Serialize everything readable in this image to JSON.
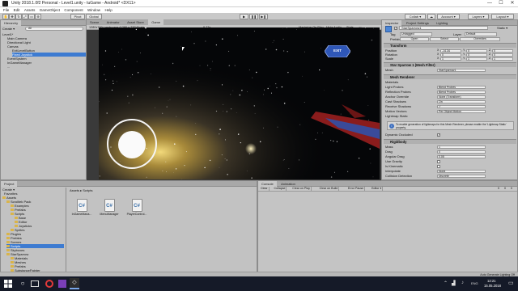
{
  "window": {
    "title": "Unity 2018.1.0f2 Personal - Level1.unity - tuGame - Android* <DX11>",
    "controls": [
      "—",
      "☐",
      "✕"
    ]
  },
  "menu": [
    "File",
    "Edit",
    "Assets",
    "GameObject",
    "Component",
    "Window",
    "Help"
  ],
  "toolbar": {
    "pivot": "Pivot",
    "global": "Global",
    "collab": "Collab ▾",
    "account": "Account ▾",
    "layers": "Layers ▾",
    "layout": "Layout ▾"
  },
  "hierarchy": {
    "tab": "Hierarchy",
    "create": "Create ▾",
    "search_placeholder": "All",
    "items": [
      {
        "label": "Level1*",
        "depth": 0
      },
      {
        "label": "Main Camera",
        "depth": 1
      },
      {
        "label": "Directional Light",
        "depth": 1
      },
      {
        "label": "Canvas",
        "depth": 1
      },
      {
        "label": "ExitLevelButton",
        "depth": 2
      },
      {
        "label": "Fixed Joystick",
        "depth": 2
      },
      {
        "label": "EventSystem",
        "depth": 1
      },
      {
        "label": "InGameManager",
        "depth": 1
      },
      {
        "label": "...",
        "depth": 1
      }
    ]
  },
  "center_tabs": [
    "Scene",
    "Animator",
    "Asset Store",
    "Game"
  ],
  "game_bar": {
    "display": "1280x720 Landscape (1280 x 720)",
    "scale_label": "Scale",
    "scale_value": "0.77x",
    "options": [
      "Maximize On Play",
      "Mute Audio",
      "Stats",
      "Gizmos ▾"
    ]
  },
  "game": {
    "exit_label": "EXIT"
  },
  "inspector": {
    "tabs": [
      "Inspector",
      "Project Settings",
      "Lighting"
    ],
    "object_name": "StarSparrow1",
    "static_label": "Static ▾",
    "tag_label": "Tag",
    "tag_value": "Untagged",
    "layer_label": "Layer",
    "layer_value": "Default",
    "prefab_label": "Prefab",
    "prefab_buttons": [
      "Open",
      "Select",
      "Overrides"
    ],
    "transform": {
      "title": "Transform",
      "rows": [
        {
          "label": "Position",
          "x": "-14.34",
          "y": "0",
          "z": "0"
        },
        {
          "label": "Rotation",
          "x": "0",
          "y": "0",
          "z": "0"
        },
        {
          "label": "Scale",
          "x": "1",
          "y": "1",
          "z": "1"
        }
      ]
    },
    "mesh_filter": {
      "title": "Star Sparrow 1 (Mesh Filter)",
      "mesh_label": "Mesh",
      "mesh_value": "StarSparrow1"
    },
    "mesh_renderer": {
      "title": "Mesh Renderer",
      "rows": [
        {
          "label": "Materials",
          "value": ""
        },
        {
          "label": "Light Probes",
          "value": "Blend Probes"
        },
        {
          "label": "Reflection Probes",
          "value": "Blend Probes"
        },
        {
          "label": "Anchor Override",
          "value": "None (Transform)"
        },
        {
          "label": "Cast Shadows",
          "value": "On"
        },
        {
          "label": "Receive Shadows",
          "value": "✓"
        },
        {
          "label": "Motion Vectors",
          "value": "Per Object Motion"
        },
        {
          "label": "Lightmap Static",
          "value": ""
        }
      ],
      "info": "To enable generation of lightmaps for this Mesh Renderer, please enable the 'Lightmap Static' property.",
      "dynamic_occluded": "Dynamic Occluded"
    },
    "rigidbody": {
      "title": "Rigidbody",
      "rows": [
        {
          "label": "Mass",
          "value": "1"
        },
        {
          "label": "Drag",
          "value": "0"
        },
        {
          "label": "Angular Drag",
          "value": "0.05"
        },
        {
          "label": "Use Gravity",
          "value": ""
        },
        {
          "label": "Is Kinematic",
          "value": ""
        },
        {
          "label": "Interpolate",
          "value": "None"
        },
        {
          "label": "Collision Detection",
          "value": "Discrete"
        }
      ]
    }
  },
  "project": {
    "tabs": [
      "Project",
      "Console",
      "Animation"
    ],
    "create": "Create ▾",
    "favorites": "Favorites",
    "tree": [
      {
        "label": "Assets",
        "depth": 0
      },
      {
        "label": "Scrolltek Pack",
        "depth": 1
      },
      {
        "label": "Examples",
        "depth": 2
      },
      {
        "label": "Prefabs",
        "depth": 2
      },
      {
        "label": "Scripts",
        "depth": 2
      },
      {
        "label": "Base",
        "depth": 3
      },
      {
        "label": "Editor",
        "depth": 3
      },
      {
        "label": "Joysticks",
        "depth": 3
      },
      {
        "label": "Sprites",
        "depth": 2
      },
      {
        "label": "Plugins",
        "depth": 1
      },
      {
        "label": "Prefabs",
        "depth": 1
      },
      {
        "label": "Scenes",
        "depth": 1
      },
      {
        "label": "Scripts",
        "depth": 1
      },
      {
        "label": "Skyboxes",
        "depth": 1
      },
      {
        "label": "StarSparrow",
        "depth": 1
      },
      {
        "label": "Materials",
        "depth": 2
      },
      {
        "label": "Meshes",
        "depth": 2
      },
      {
        "label": "Prefabs",
        "depth": 2
      },
      {
        "label": "SubstancePainter",
        "depth": 2
      },
      {
        "label": "Textures",
        "depth": 2
      }
    ],
    "breadcrumb": "Assets ▸ Scripts",
    "assets": [
      {
        "name": "InGameMana..."
      },
      {
        "name": "MenuManager"
      },
      {
        "name": "PlayerControl..."
      }
    ]
  },
  "console": {
    "buttons": [
      "Clear",
      "Collapse",
      "Clear on Play",
      "Clear on Build",
      "Error Pause",
      "Editor ▾"
    ],
    "counts": [
      "0",
      "0",
      "0"
    ]
  },
  "statusbar": {
    "text": "Auto Generate Lighting Off"
  },
  "taskbar": {
    "time": "12:21",
    "date": "15.05.2018",
    "lang": "ENG"
  },
  "colors": {
    "selection": "#3d7bd1",
    "editor_bg": "#c2c2c2",
    "taskbar": "#151a28",
    "exit_button": "#2f57b8"
  }
}
